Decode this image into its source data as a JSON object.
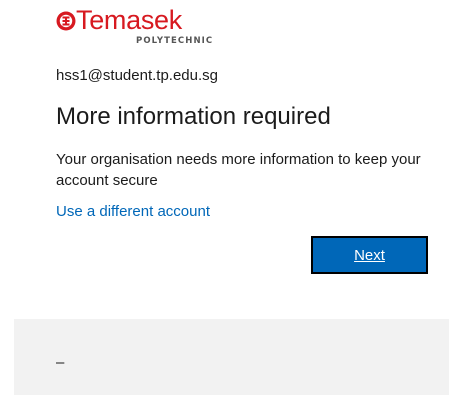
{
  "brand": {
    "name": "Temasek",
    "subtitle": "POLYTECHNIC",
    "color": "#d71920",
    "icon": "temasek-logo-mark"
  },
  "account": {
    "email": "hss1@student.tp.edu.sg"
  },
  "main": {
    "title": "More information required",
    "description": "Your organisation needs more information to keep your account secure",
    "alt_account_link": "Use a different account",
    "next_label": "Next",
    "accent": "#0067b8"
  },
  "footer": {
    "text": "–"
  }
}
